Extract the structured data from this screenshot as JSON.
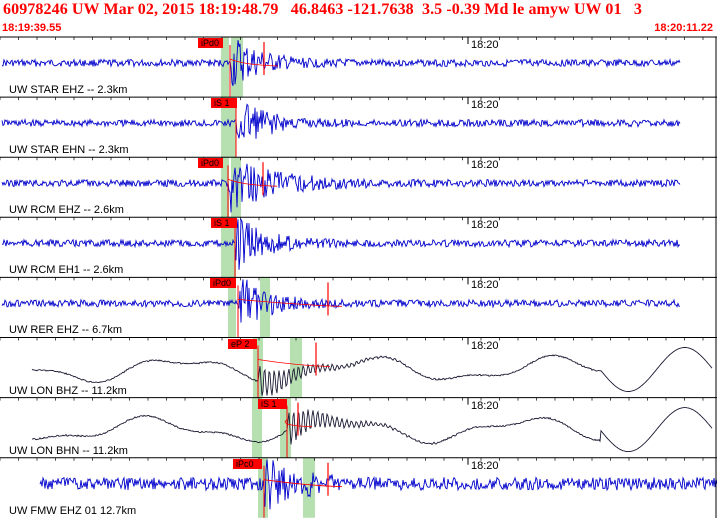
{
  "header": {
    "title": "60978246 UW Mar 02, 2015 18:19:48.79   46.8463 -121.7638  3.5 -0.39 Md le amyw UW 01   3",
    "start_time": "18:19:39.55",
    "end_time": "18:20:11.22"
  },
  "colors": {
    "header_text": "#ff0000",
    "trace_short_period": "#0000cc",
    "trace_broadband": "#1a1a33",
    "pick_flag": "#ff0000",
    "pick_window": "#b7e0b0",
    "panel_border": "#000000"
  },
  "panels": [
    {
      "label": "UW STAR EHZ -- 2.3km",
      "time_mark": "18:20",
      "pick": "iPd0",
      "type": "short"
    },
    {
      "label": "UW STAR EHN -- 2.3km",
      "time_mark": "18:20",
      "pick": "iS 1",
      "type": "short"
    },
    {
      "label": "UW RCM EHZ -- 2.6km",
      "time_mark": "18:20",
      "pick": "iPd0",
      "type": "short"
    },
    {
      "label": "UW RCM EH1 -- 2.6km",
      "time_mark": "18:20",
      "pick": "iS 1",
      "type": "short"
    },
    {
      "label": "UW RER EHZ -- 6.7km",
      "time_mark": "18:20",
      "pick": "iPd0",
      "type": "short"
    },
    {
      "label": "UW LON BHZ -- 11.2km",
      "time_mark": "18:20",
      "pick": "eP 2",
      "type": "broad"
    },
    {
      "label": "UW LON BHN -- 11.2km",
      "time_mark": "18:20",
      "pick": "iS 1",
      "type": "broad"
    },
    {
      "label": "UW FMW EHZ 01 12.7km",
      "time_mark": "18:20",
      "pick": "iPc0",
      "type": "noisy"
    }
  ]
}
